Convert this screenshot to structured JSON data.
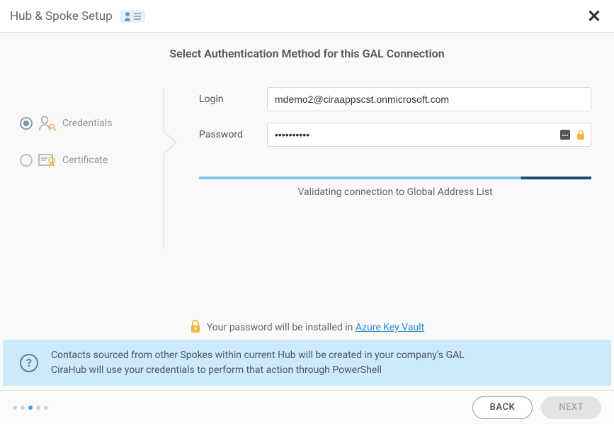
{
  "header": {
    "title": "Hub & Spoke Setup",
    "icon": "user-list-icon"
  },
  "page": {
    "heading": "Select Authentication Method for this GAL Connection"
  },
  "auth_options": {
    "credentials": {
      "label": "Credentials",
      "selected": true
    },
    "certificate": {
      "label": "Certificate",
      "selected": false
    }
  },
  "form": {
    "login_label": "Login",
    "login_value": "mdemo2@ciraappscst.onmicrosoft.com",
    "password_label": "Password",
    "password_value": "••••••••••"
  },
  "progress": {
    "status": "Validating connection to Global Address List",
    "percent": 82
  },
  "keyvault": {
    "prefix": "Your password will be installed in ",
    "link_text": "Azure Key Vault"
  },
  "info": {
    "line1": "Contacts sourced from other Spokes within current Hub will be created in your company's GAL",
    "line2": "CiraHub will use your credentials to perform that action through PowerShell"
  },
  "footer": {
    "back": "BACK",
    "next": "NEXT",
    "step_count": 5,
    "current_step": 3
  },
  "colors": {
    "accent": "#3aa5e0",
    "banner": "#cdeafb",
    "lock": "#f2b94a"
  }
}
